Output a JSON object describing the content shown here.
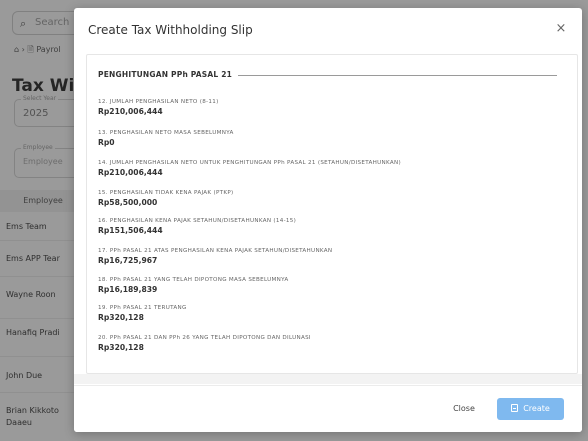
{
  "background": {
    "search_placeholder": "Search",
    "breadcrumb": "⌂ › 🗎 Payrol",
    "page_title": "Tax With",
    "year_field": {
      "label": "Select Year",
      "value": "2025"
    },
    "employee_field": {
      "label": "Employee",
      "placeholder": "Employee"
    },
    "column_header": "Employee",
    "rows": [
      "Ems Team",
      "Ems APP Tear",
      "Wayne Roon",
      "Hanafiq Pradi",
      "John Due",
      "Brian Kikkoto",
      "Daaeu"
    ]
  },
  "modal": {
    "title": "Create Tax Withholding Slip",
    "close_glyph": "×",
    "section_title": "PENGHITUNGAN PPh PASAL 21",
    "items": [
      {
        "label": "12. JUMLAH PENGHASILAN NETO (8-11)",
        "value": "Rp210,006,444"
      },
      {
        "label": "13. PENGHASILAN NETO MASA SEBELUMNYA",
        "value": "Rp0"
      },
      {
        "label": "14. JUMLAH PENGHASILAN NETO UNTUK PENGHITUNGAN PPh PASAL 21 (SETAHUN/DISETAHUNKAN)",
        "value": "Rp210,006,444"
      },
      {
        "label": "15. PENGHASILAN TIDAK KENA PAJAK (PTKP)",
        "value": "Rp58,500,000"
      },
      {
        "label": "16. PENGHASILAN KENA PAJAK SETAHUN/DISETAHUNKAN (14-15)",
        "value": "Rp151,506,444"
      },
      {
        "label": "17. PPh PASAL 21 ATAS PENGHASILAN KENA PAJAK SETAHUN/DISETAHUNKAN",
        "value": "Rp16,725,967"
      },
      {
        "label": "18. PPh PASAL 21 YANG TELAH DIPOTONG MASA SEBELUMNYA",
        "value": "Rp16,189,839"
      },
      {
        "label": "19. PPh PASAL 21 TERUTANG",
        "value": "Rp320,128"
      },
      {
        "label": "20. PPh PASAL 21 DAN PPh 26 YANG TELAH DIPOTONG DAN DILUNASI",
        "value": "Rp320,128"
      }
    ],
    "footer": {
      "close_label": "Close",
      "create_label": "Create"
    }
  },
  "colors": {
    "accent": "#7fb9ef",
    "overlay": "#282828"
  }
}
